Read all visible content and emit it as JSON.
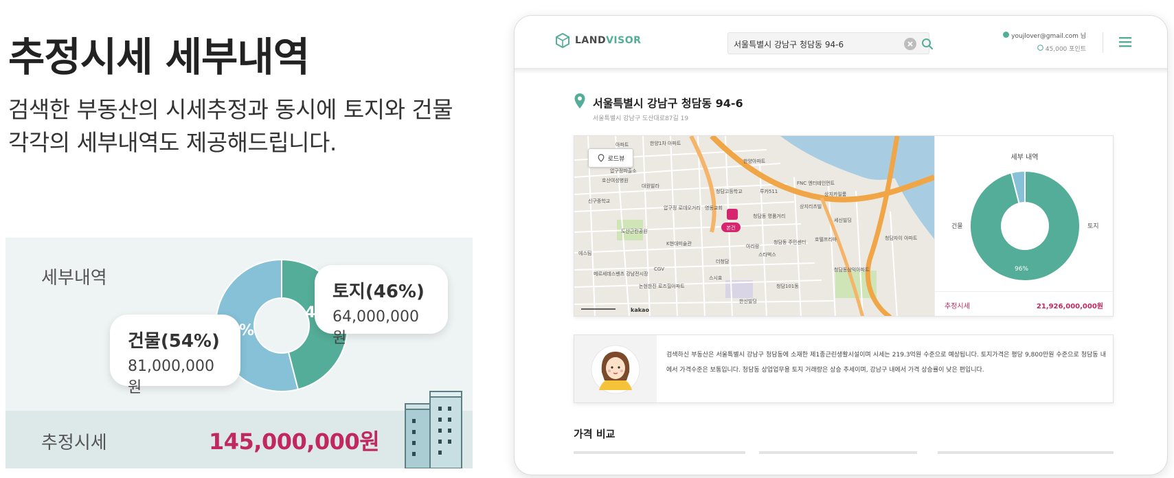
{
  "promo": {
    "headline": "추정시세 세부내역",
    "subtext": "검색한 부동산의 시세추정과 동시에 토지와 건물 각각의 세부내역도 제공해드립니다."
  },
  "detail_card": {
    "title": "세부내역",
    "footer_label": "추정시세",
    "footer_value": "145,000,000원",
    "land_bubble": {
      "title": "토지(46%)",
      "amount": "64,000,000원"
    },
    "building_bubble": {
      "title": "건물(54%)",
      "amount": "81,000,000원"
    },
    "donut_peek_left": "%",
    "donut_peek_right": "4",
    "colors": {
      "land": "#54ad98",
      "building": "#86c1d8",
      "price": "#c0285e"
    }
  },
  "chart_data": {
    "type": "pie",
    "categories": [
      "토지",
      "건물"
    ],
    "values": [
      46,
      54
    ],
    "title": "",
    "xlabel": "",
    "ylabel": ""
  },
  "app": {
    "logo": {
      "prefix": "LAND",
      "accent": "VISOR"
    },
    "search": {
      "value": "서울특별시 강남구 청담동 94-6",
      "placeholder": ""
    },
    "user": {
      "email": "youjlover@gmail.com 님",
      "points": "45,000 포인트"
    },
    "address": {
      "title": "서울특별시 강남구 청담동 94-6",
      "sub": "서울특별시 강남구 도산대로87길 19"
    },
    "map": {
      "roadview_label": "로드뷰",
      "attribution": "kakao",
      "place_labels": [
        "아파트",
        "한양1차 아파트",
        "압구정파출소",
        "호산여성병원",
        "대원빌라",
        "신구중학교",
        "압구정 로데오거리",
        "청담고등학교",
        "루카511",
        "한양아파트",
        "FNC 엔터테인먼트",
        "영동교회",
        "청담동 명품거리",
        "상지리츠빌",
        "도산근린공원",
        "K현대미술관",
        "메르세데스벤츠 강남전시장",
        "CGV",
        "아리랑",
        "스타벅스",
        "더청담",
        "스시효",
        "청담동 주민센터",
        "호텔프리마",
        "상지카일룸",
        "청담동삼익아파트",
        "청담자이 아파트",
        "세신빌딩",
        "에스팀",
        "논현한진 로즈힐아파트",
        "청담101동",
        "한신빌딩",
        "본건"
      ]
    },
    "detail_panel": {
      "title": "세부 내역",
      "building_label": "건물",
      "land_label": "토지",
      "percent_label": "96%",
      "footer_label": "추정시세",
      "footer_value": "21,926,000,000원",
      "chart_data": {
        "type": "pie",
        "categories": [
          "토지",
          "건물"
        ],
        "values": [
          96,
          4
        ]
      }
    },
    "info_text": "검색하신 부동산은 서울특별시 강남구 청담동에 소재한 제1종근린생활시설이며 시세는 219.3억원 수준으로 예상됩니다. 토지가격은 평당 9,800만원 수준으로 청담동 내에서 가격수준은 보통입니다. 청담동 상업업무용 토지 거래량은 상승 추세이며, 강남구 내에서 가격 상승률이 낮은 편입니다.",
    "compare_title": "가격 비교"
  }
}
